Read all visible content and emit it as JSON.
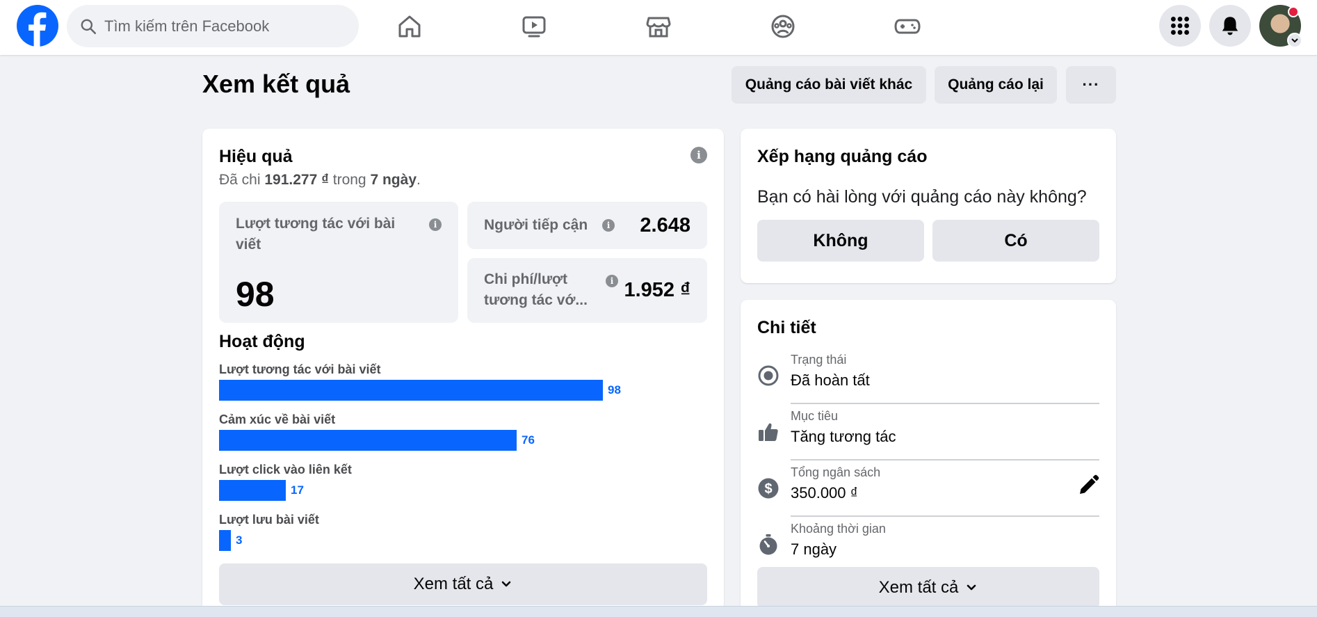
{
  "search": {
    "placeholder": "Tìm kiếm trên Facebook"
  },
  "nav": {
    "icons": [
      "home-icon",
      "video-icon",
      "marketplace-icon",
      "groups-icon",
      "gaming-icon"
    ],
    "right_icons": [
      "menu-grid-icon",
      "notifications-bell-icon",
      "profile-avatar"
    ]
  },
  "header": {
    "title": "Xem kết quả",
    "boost_other_label": "Quảng cáo bài viết khác",
    "boost_again_label": "Quảng cáo lại",
    "more_label": "···"
  },
  "performance": {
    "title": "Hiệu quả",
    "spent_prefix": "Đã chi",
    "spent_amount": "191.277 ₫",
    "spent_mid": "trong",
    "spent_days": "7 ngày",
    "spent_suffix": ".",
    "metrics": {
      "engagement_label": "Lượt tương tác với bài viết",
      "engagement_value": "98",
      "reach_label": "Người tiếp cận",
      "reach_value": "2.648",
      "cost_label": "Chi phí/lượt tương tác vớ...",
      "cost_value": "1.952 ₫"
    }
  },
  "activity": {
    "title": "Hoạt động",
    "max": 98,
    "items": [
      {
        "label": "Lượt tương tác với bài viết",
        "value": 98
      },
      {
        "label": "Cảm xúc về bài viết",
        "value": 76
      },
      {
        "label": "Lượt click vào liên kết",
        "value": 17
      },
      {
        "label": "Lượt lưu bài viết",
        "value": 3
      }
    ],
    "see_all_label": "Xem tất cả"
  },
  "rating": {
    "title": "Xếp hạng quảng cáo",
    "question": "Bạn có hài lòng với quảng cáo này không?",
    "no_label": "Không",
    "yes_label": "Có"
  },
  "details": {
    "title": "Chi tiết",
    "rows": [
      {
        "label": "Trạng thái",
        "value": "Đã hoàn tất",
        "icon": "status-radio-icon"
      },
      {
        "label": "Mục tiêu",
        "value": "Tăng tương tác",
        "icon": "thumbs-up-icon"
      },
      {
        "label": "Tổng ngân sách",
        "value": "350.000 ₫",
        "icon": "dollar-icon"
      },
      {
        "label": "Khoảng thời gian",
        "value": "7 ngày",
        "icon": "stopwatch-icon"
      }
    ],
    "see_all_label": "Xem tất cả"
  },
  "colors": {
    "accent": "#0866ff",
    "fb_blue": "#0866ff",
    "notification_dot": "#e41e3f"
  }
}
